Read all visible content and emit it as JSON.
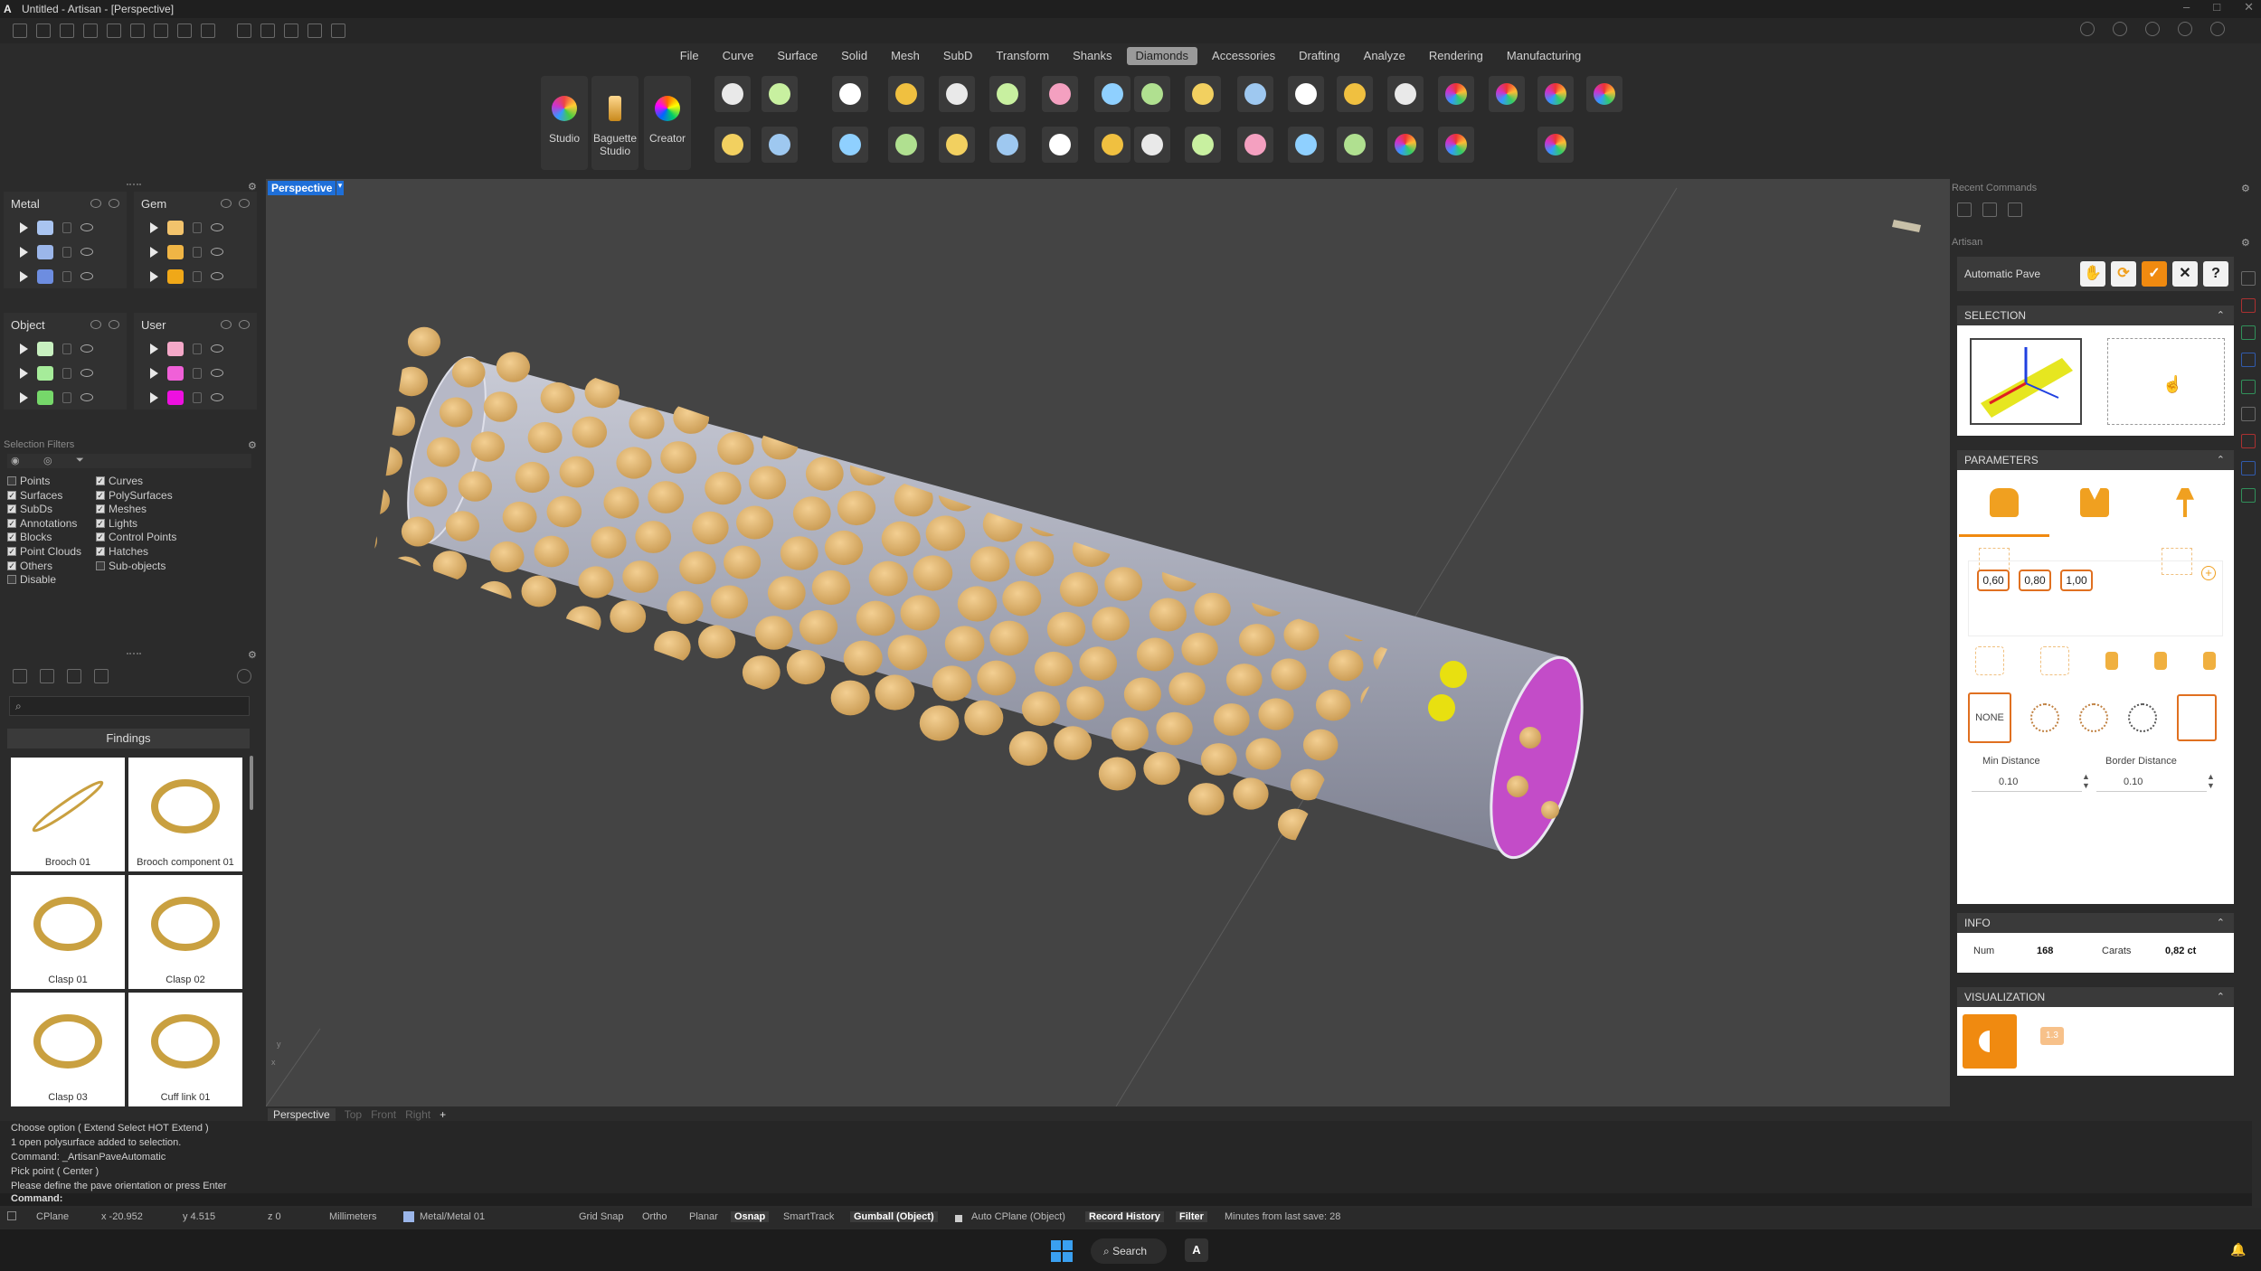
{
  "window": {
    "title": "Untitled - Artisan - [Perspective]"
  },
  "menu": [
    "File",
    "Curve",
    "Surface",
    "Solid",
    "Mesh",
    "SubD",
    "Transform",
    "Shanks",
    "Diamonds",
    "Accessories",
    "Drafting",
    "Analyze",
    "Rendering",
    "Manufacturing"
  ],
  "menu_active": "Diamonds",
  "ribbon": {
    "studio": "Studio",
    "baguette_studio": "Baguette Studio",
    "creator": "Creator"
  },
  "layers": {
    "metal": {
      "title": "Metal",
      "colors": [
        "#a9c4f0",
        "#9bb6ea",
        "#6d8de0"
      ]
    },
    "gem": {
      "title": "Gem",
      "colors": [
        "#f2c36c",
        "#f0b545",
        "#f0a818"
      ]
    },
    "object": {
      "title": "Object",
      "colors": [
        "#c8f0c0",
        "#a6ec9a",
        "#76d86a"
      ]
    },
    "user": {
      "title": "User",
      "colors": [
        "#f4a8c8",
        "#f060d8",
        "#ee10e0"
      ]
    }
  },
  "selection_filters": {
    "title": "Selection Filters",
    "left": [
      {
        "label": "Points",
        "on": false
      },
      {
        "label": "Surfaces",
        "on": true
      },
      {
        "label": "SubDs",
        "on": true
      },
      {
        "label": "Annotations",
        "on": true
      },
      {
        "label": "Blocks",
        "on": true
      },
      {
        "label": "Point Clouds",
        "on": true
      },
      {
        "label": "Others",
        "on": true
      },
      {
        "label": "Disable",
        "on": false
      }
    ],
    "right": [
      {
        "label": "Curves",
        "on": true
      },
      {
        "label": "PolySurfaces",
        "on": true
      },
      {
        "label": "Meshes",
        "on": true
      },
      {
        "label": "Lights",
        "on": true
      },
      {
        "label": "Control Points",
        "on": true
      },
      {
        "label": "Hatches",
        "on": true
      },
      {
        "label": "Sub-objects",
        "on": false
      }
    ]
  },
  "findings": {
    "header": "Findings",
    "items": [
      "Brooch 01",
      "Brooch component 01",
      "Clasp 01",
      "Clasp 02",
      "Clasp 03",
      "Cuff link 01"
    ]
  },
  "viewport": {
    "active_tab": "Perspective",
    "tabs": [
      "Perspective",
      "Top",
      "Front",
      "Right"
    ],
    "add_tab": "+",
    "axis_x": "x",
    "axis_y": "y"
  },
  "right_panel": {
    "recent_commands": "Recent Commands",
    "artisan": "Artisan",
    "command": "Automatic Pave",
    "help": "?",
    "selection": "SELECTION",
    "parameters": "PARAMETERS",
    "sizes": [
      "0,60",
      "0,80",
      "1,00"
    ],
    "none_label": "NONE",
    "min_distance_label": "Min Distance",
    "min_distance": "0.10",
    "border_distance_label": "Border Distance",
    "border_distance": "0.10",
    "info": "INFO",
    "num_label": "Num",
    "num": "168",
    "carats_label": "Carats",
    "carats": "0,82 ct",
    "visualization": "VISUALIZATION",
    "vis_badge": "1.3"
  },
  "command_history": [
    "Choose option ( Extend  Select  HOT  Extend  )",
    "1 open polysurface added to selection.",
    "Command: _ArtisanPaveAutomatic",
    "Pick point ( Center )",
    "Please define the pave orientation or press Enter"
  ],
  "command_prompt": "Command:",
  "status": {
    "cplane": "CPlane",
    "x": "x -20.952",
    "y": "y 4.515",
    "z": "z 0",
    "units": "Millimeters",
    "layer": "Metal/Metal 01",
    "grid_snap": "Grid Snap",
    "ortho": "Ortho",
    "planar": "Planar",
    "osnap": "Osnap",
    "smarttrack": "SmartTrack",
    "gumball": "Gumball (Object)",
    "auto_cplane": "Auto CPlane (Object)",
    "record_history": "Record History",
    "filter": "Filter",
    "minutes": "Minutes from last save: 28"
  },
  "taskbar": {
    "search": "Search"
  }
}
